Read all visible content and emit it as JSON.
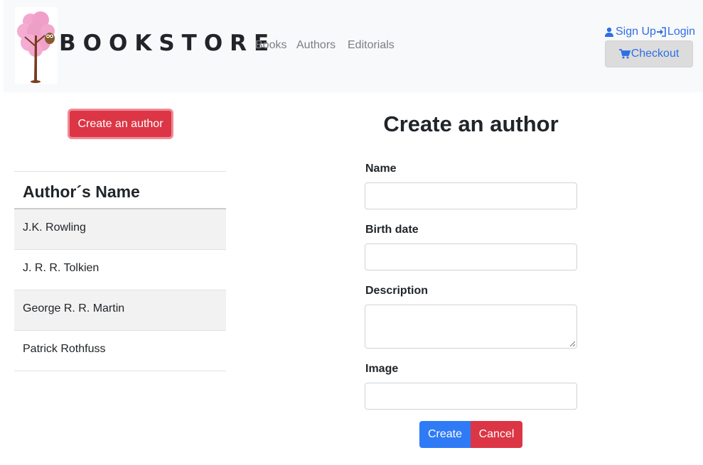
{
  "header": {
    "brand": "BOOKSTORE",
    "logo_icon": "tree-owl-logo",
    "nav": [
      {
        "label": "Books"
      },
      {
        "label": "Authors"
      },
      {
        "label": "Editorials"
      }
    ],
    "signup_label": "Sign Up",
    "login_label": "Login",
    "checkout_label": "Checkout",
    "link_color": "#2f6fe4"
  },
  "sidebar": {
    "create_button_label": "Create an author",
    "table_header": "Author´s Name",
    "authors": [
      {
        "name": "J.K. Rowling"
      },
      {
        "name": "J. R. R. Tolkien"
      },
      {
        "name": "George R. R. Martin"
      },
      {
        "name": "Patrick Rothfuss"
      }
    ]
  },
  "form": {
    "title": "Create an author",
    "fields": {
      "name": {
        "label": "Name",
        "value": ""
      },
      "birth_date": {
        "label": "Birth date",
        "value": ""
      },
      "description": {
        "label": "Description",
        "value": ""
      },
      "image": {
        "label": "Image",
        "value": ""
      }
    },
    "create_label": "Create",
    "cancel_label": "Cancel"
  },
  "colors": {
    "danger": "#dc3545",
    "primary": "#2f7bf6"
  }
}
